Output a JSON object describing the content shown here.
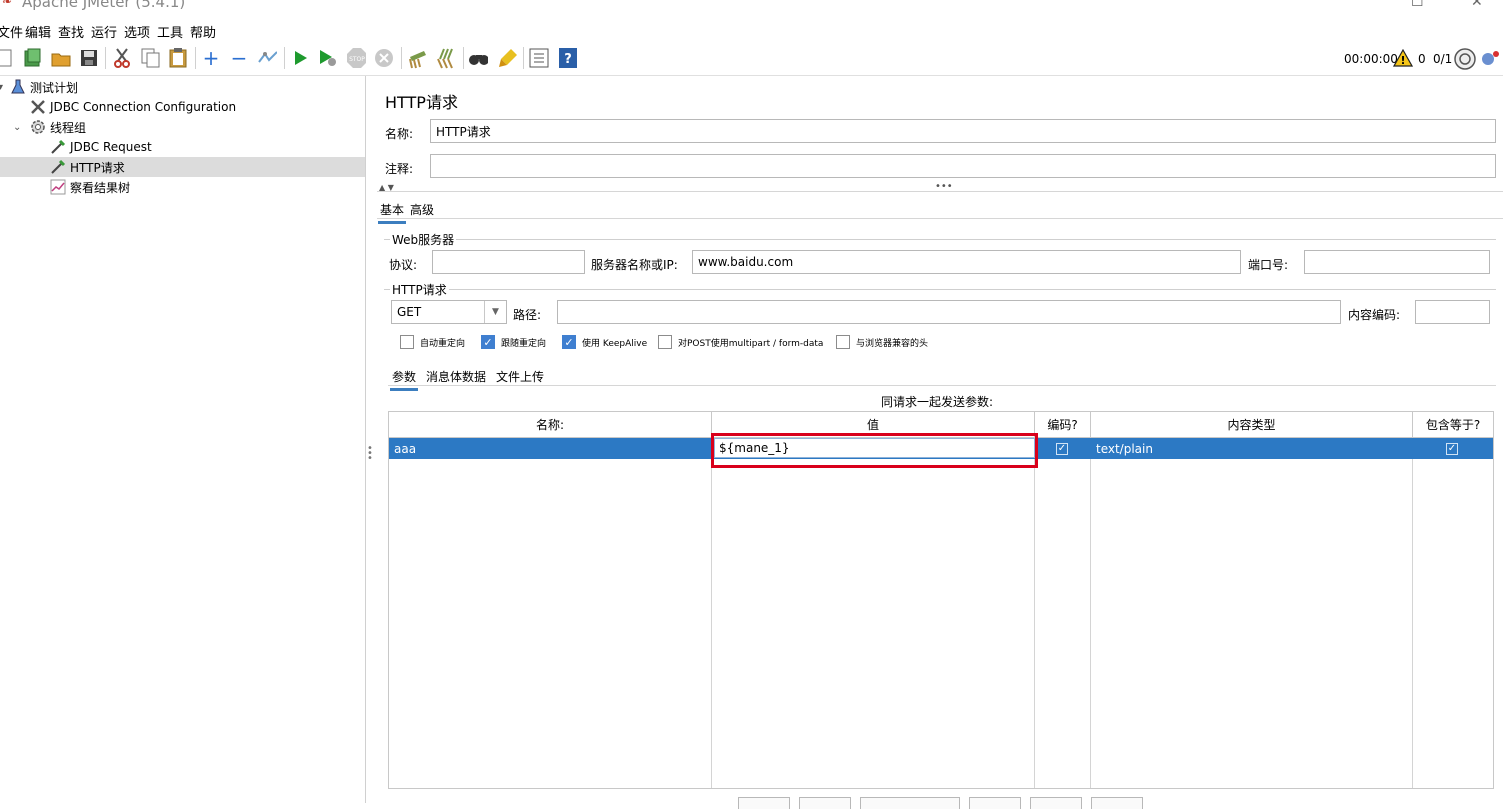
{
  "window": {
    "title": "Apache JMeter (5.4.1)",
    "minimize": "☐",
    "close": "✕"
  },
  "menu": [
    "文件",
    "编辑",
    "查找",
    "运行",
    "选项",
    "工具",
    "帮助"
  ],
  "toolbar": {
    "timer": "00:00:00",
    "errors": "0",
    "threads": "0/1"
  },
  "tree": {
    "items": [
      {
        "label": "测试计划"
      },
      {
        "label": "JDBC Connection Configuration"
      },
      {
        "label": "线程组"
      },
      {
        "label": "JDBC Request"
      },
      {
        "label": "HTTP请求"
      },
      {
        "label": "察看结果树"
      }
    ]
  },
  "panel": {
    "title": "HTTP请求",
    "name_label": "名称:",
    "name_value": "HTTP请求",
    "comment_label": "注释:",
    "comment_value": "",
    "tabs": [
      "基本",
      "高级"
    ],
    "web_server": {
      "legend": "Web服务器",
      "protocol_label": "协议:",
      "protocol_value": "",
      "server_label": "服务器名称或IP:",
      "server_value": "www.baidu.com",
      "port_label": "端口号:",
      "port_value": ""
    },
    "http_request": {
      "legend": "HTTP请求",
      "method": "GET",
      "path_label": "路径:",
      "path_value": "",
      "encoding_label": "内容编码:",
      "encoding_value": ""
    },
    "checkboxes": [
      {
        "label": "自动重定向",
        "checked": false
      },
      {
        "label": "跟随重定向",
        "checked": true
      },
      {
        "label": "使用 KeepAlive",
        "checked": true
      },
      {
        "label": "对POST使用multipart / form-data",
        "checked": false
      },
      {
        "label": "与浏览器兼容的头",
        "checked": false
      }
    ],
    "subtabs": [
      "参数",
      "消息体数据",
      "文件上传"
    ],
    "params_caption": "同请求一起发送参数:",
    "table": {
      "headers": [
        "名称:",
        "值",
        "编码?",
        "内容类型",
        "包含等于?"
      ],
      "rows": [
        {
          "name": "aaa",
          "value": "${mane_1}",
          "encode": true,
          "content_type": "text/plain",
          "include_equals": true
        }
      ]
    }
  },
  "colors": {
    "selection": "#2c79c4",
    "highlight": "#d9001b",
    "accent": "#3c7ebf"
  }
}
